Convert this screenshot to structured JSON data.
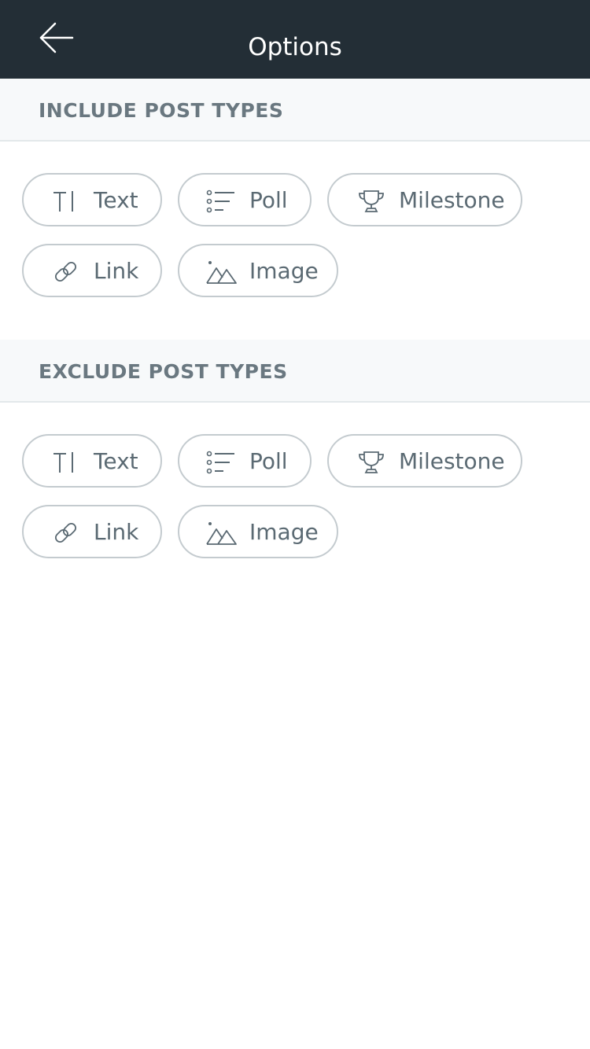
{
  "header": {
    "title": "Options",
    "back_icon": "arrow-left-icon"
  },
  "include": {
    "title": "INCLUDE POST TYPES",
    "chips": [
      {
        "label": "Text",
        "icon": "text-icon"
      },
      {
        "label": "Poll",
        "icon": "poll-icon"
      },
      {
        "label": "Milestone",
        "icon": "trophy-icon"
      },
      {
        "label": "Link",
        "icon": "link-icon"
      },
      {
        "label": "Image",
        "icon": "image-icon"
      }
    ]
  },
  "exclude": {
    "title": "EXCLUDE POST TYPES",
    "chips": [
      {
        "label": "Text",
        "icon": "text-icon"
      },
      {
        "label": "Poll",
        "icon": "poll-icon"
      },
      {
        "label": "Milestone",
        "icon": "trophy-icon"
      },
      {
        "label": "Link",
        "icon": "link-icon"
      },
      {
        "label": "Image",
        "icon": "image-icon"
      }
    ]
  },
  "colors": {
    "nav_background": "#232e36",
    "section_background": "#f7f9fa",
    "chip_border": "#c4cbcf",
    "chip_text": "#5b6a73",
    "section_title": "#6a7880"
  }
}
